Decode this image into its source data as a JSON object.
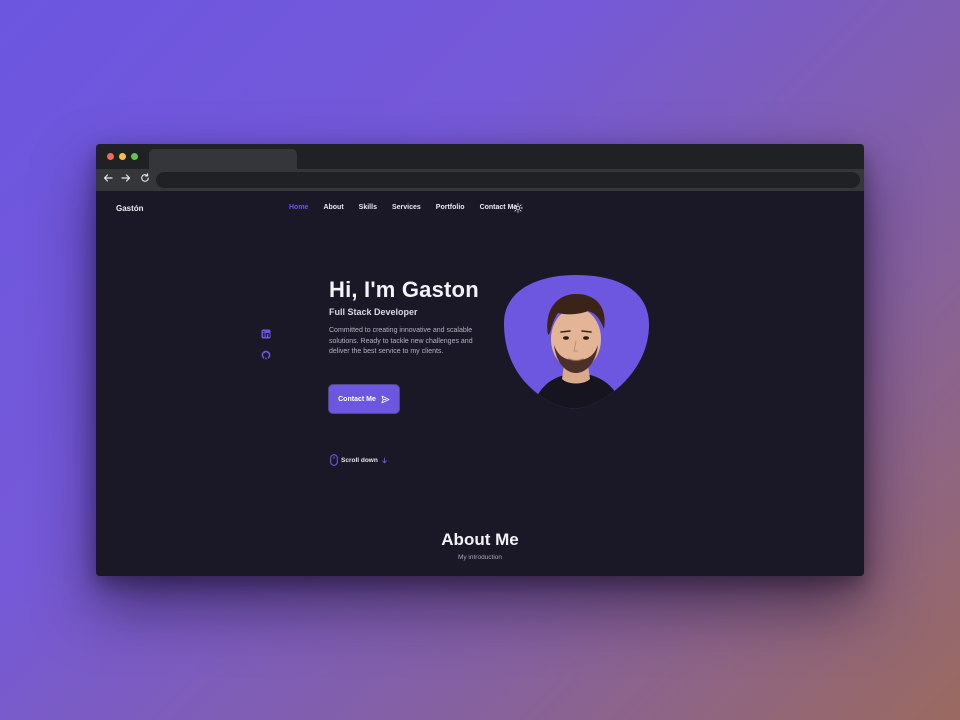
{
  "browser": {
    "tab_title": "",
    "url": ""
  },
  "nav": {
    "logo": "Gastón",
    "items": [
      {
        "label": "Home",
        "active": true
      },
      {
        "label": "About",
        "active": false
      },
      {
        "label": "Skills",
        "active": false
      },
      {
        "label": "Services",
        "active": false
      },
      {
        "label": "Portfolio",
        "active": false
      },
      {
        "label": "Contact Me",
        "active": false
      }
    ],
    "theme_toggle_icon": "sun-icon"
  },
  "social": {
    "icons": [
      "linkedin-icon",
      "github-icon"
    ]
  },
  "hero": {
    "title": "Hi, I'm Gaston",
    "subtitle": "Full Stack Developer",
    "description": "Committed to creating innovative and scalable solutions. Ready to tackle new challenges and deliver the best service to my clients.",
    "cta_label": "Contact Me",
    "cta_icon": "send-icon",
    "scroll_label": "Scroll down"
  },
  "about": {
    "title": "About Me",
    "subtitle": "My introduction"
  },
  "colors": {
    "accent": "#6e57e0",
    "page_background": "#1a1726",
    "browser_chrome": "#202124"
  }
}
